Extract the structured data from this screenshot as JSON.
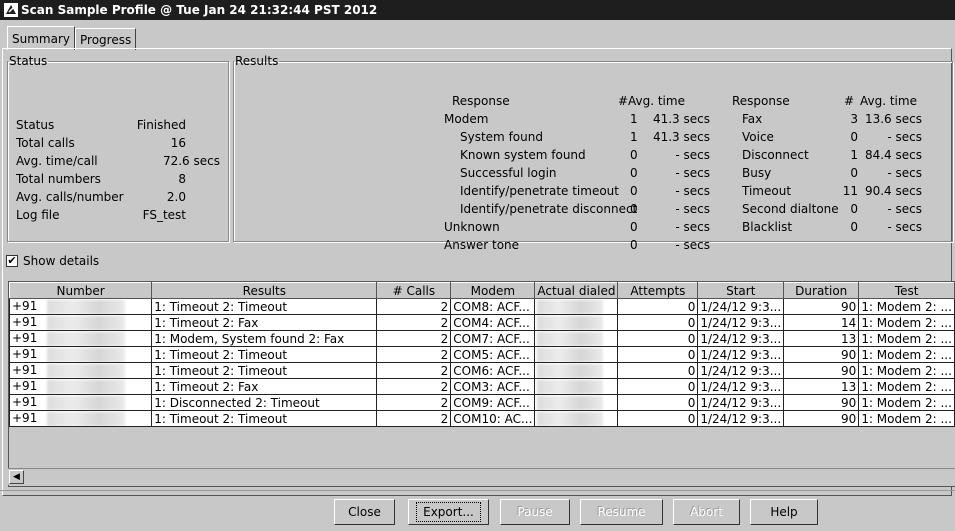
{
  "window": {
    "title": "Scan Sample Profile @ Tue Jan 24 21:32:44 PST 2012"
  },
  "tabs": [
    {
      "label": "Summary"
    },
    {
      "label": "Progress"
    }
  ],
  "status": {
    "legend": "Status",
    "rows": [
      {
        "label": "Status",
        "value": "Finished"
      },
      {
        "label": "Total calls",
        "value": "16"
      },
      {
        "label": "Avg. time/call",
        "value": "72.6 secs"
      },
      {
        "label": "Total numbers",
        "value": "8"
      },
      {
        "label": "Avg. calls/number",
        "value": "2.0"
      },
      {
        "label": "Log file",
        "value": "FS_test"
      }
    ]
  },
  "results": {
    "legend": "Results",
    "left": {
      "h_response": "Response",
      "h_count": "#",
      "h_time": "Avg. time",
      "rows": [
        {
          "label": "Modem",
          "count": "1",
          "time": "41.3 secs"
        },
        {
          "label": "System found",
          "count": "1",
          "time": "41.3 secs"
        },
        {
          "label": "Known system found",
          "count": "0",
          "time": "- secs"
        },
        {
          "label": "Successful login",
          "count": "0",
          "time": "- secs"
        },
        {
          "label": "Identify/penetrate timeout",
          "count": "0",
          "time": "- secs"
        },
        {
          "label": "Identify/penetrate disconnect",
          "count": "0",
          "time": "- secs"
        },
        {
          "label": "Unknown",
          "count": "0",
          "time": "- secs"
        },
        {
          "label": "Answer tone",
          "count": "0",
          "time": "- secs"
        }
      ]
    },
    "right": {
      "h_response": "Response",
      "h_count": "#",
      "h_time": "Avg. time",
      "rows": [
        {
          "label": "Fax",
          "count": "3",
          "time": "13.6 secs"
        },
        {
          "label": "Voice",
          "count": "0",
          "time": "- secs"
        },
        {
          "label": "Disconnect",
          "count": "1",
          "time": "84.4 secs"
        },
        {
          "label": "Busy",
          "count": "0",
          "time": "- secs"
        },
        {
          "label": "Timeout",
          "count": "11",
          "time": "90.4 secs"
        },
        {
          "label": "Second dialtone",
          "count": "0",
          "time": "- secs"
        },
        {
          "label": "Blacklist",
          "count": "0",
          "time": "- secs"
        }
      ]
    }
  },
  "details": {
    "show_label": "Show details",
    "checked": true,
    "check_glyph": "✔"
  },
  "table": {
    "columns": [
      "Number",
      "Results",
      "# Calls",
      "Modem",
      "Actual dialed",
      "Attempts",
      "Start",
      "Duration",
      "Test"
    ],
    "rows": [
      {
        "number": "+91",
        "results": "1: Timeout 2: Timeout",
        "calls": "2",
        "modem": "COM8: ACF...",
        "attempts": "0",
        "start": "1/24/12 9:3...",
        "duration": "90",
        "test": "1: Modem 2: ..."
      },
      {
        "number": "+91",
        "results": "1: Timeout 2: Fax",
        "calls": "2",
        "modem": "COM4: ACF...",
        "attempts": "0",
        "start": "1/24/12 9:3...",
        "duration": "14",
        "test": "1: Modem 2: ..."
      },
      {
        "number": "+91",
        "results": "1: Modem, System found 2: Fax",
        "calls": "2",
        "modem": "COM7: ACF...",
        "attempts": "0",
        "start": "1/24/12 9:3...",
        "duration": "13",
        "test": "1: Modem 2: ..."
      },
      {
        "number": "+91",
        "results": "1: Timeout 2: Timeout",
        "calls": "2",
        "modem": "COM5: ACF...",
        "attempts": "0",
        "start": "1/24/12 9:3...",
        "duration": "90",
        "test": "1: Modem 2: ..."
      },
      {
        "number": "+91",
        "results": "1: Timeout 2: Timeout",
        "calls": "2",
        "modem": "COM6: ACF...",
        "attempts": "0",
        "start": "1/24/12 9:3...",
        "duration": "90",
        "test": "1: Modem 2: ..."
      },
      {
        "number": "+91",
        "results": "1: Timeout 2: Fax",
        "calls": "2",
        "modem": "COM3: ACF...",
        "attempts": "0",
        "start": "1/24/12 9:3...",
        "duration": "13",
        "test": "1: Modem 2: ..."
      },
      {
        "number": "+91",
        "results": "1: Disconnected 2: Timeout",
        "calls": "2",
        "modem": "COM9: ACF...",
        "attempts": "0",
        "start": "1/24/12 9:3...",
        "duration": "90",
        "test": "1: Modem 2: ..."
      },
      {
        "number": "+91",
        "results": "1: Timeout 2: Timeout",
        "calls": "2",
        "modem": "COM10: AC...",
        "attempts": "0",
        "start": "1/24/12 9:3...",
        "duration": "90",
        "test": "1: Modem 2: ..."
      }
    ]
  },
  "scrollbar": {
    "left_arrow": "◀"
  },
  "buttons": {
    "close": "Close",
    "export": "Export...",
    "pause": "Pause",
    "resume": "Resume",
    "abort": "Abort",
    "help": "Help"
  }
}
